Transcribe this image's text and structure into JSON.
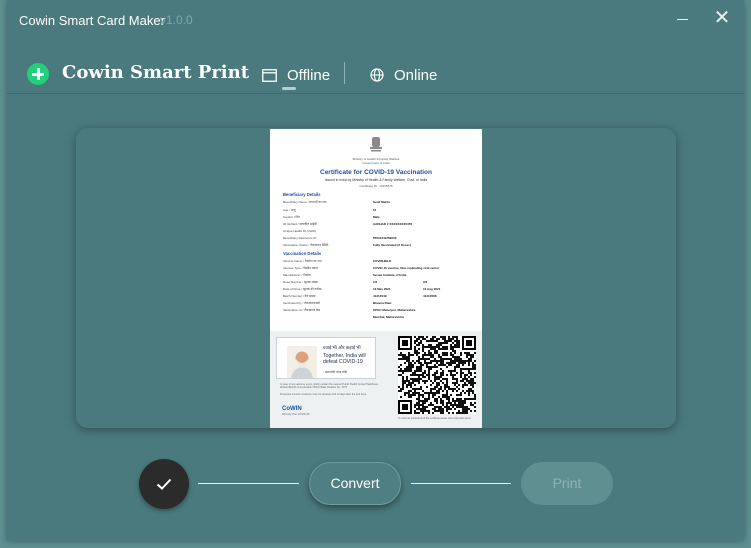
{
  "window": {
    "title": "Cowin Smart Card Maker",
    "version": "v1.0.0",
    "minimize_icon": "minimize-icon",
    "close_icon": "close-icon"
  },
  "header": {
    "brand": "Cowin Smart Print",
    "brand_icon": "plus-circle-icon",
    "tabs": [
      {
        "label": "Offline",
        "icon": "window-icon",
        "active": true
      },
      {
        "label": "Online",
        "icon": "globe-icon",
        "active": false
      }
    ]
  },
  "certificate": {
    "header_line1": "Ministry of Health & Family Welfare",
    "header_line2": "Government of India",
    "title": "Certificate for COVID-19 Vaccination",
    "subtitle": "Issued in India by Ministry of Health & Family Welfare, Govt. of India",
    "cert_id": "Certificate ID : 12345678",
    "sections": {
      "beneficiary": "Beneficiary Details",
      "vaccination": "Vaccination Details"
    },
    "beneficiary_rows": [
      {
        "key": "Beneficiary Name / लाभार्थी का नाम",
        "value": "Sunil Mehta"
      },
      {
        "key": "Age / आयु",
        "value": "51"
      },
      {
        "key": "Gender / लिंग",
        "value": "Male"
      },
      {
        "key": "ID Verified / सत्यापित आईडी",
        "value": "AADHAR # XXXXXXXX5478"
      },
      {
        "key": "Unique Health ID (UHID)",
        "value": ""
      },
      {
        "key": "Beneficiary Reference ID",
        "value": "55512341259000"
      },
      {
        "key": "Vaccination Status / टीकाकरण स्थिति",
        "value": "Fully Vaccinated (2 Doses)"
      }
    ],
    "vaccination_rows": [
      {
        "key": "Vaccine Name / वैक्सीन का नाम",
        "value": "COVISHIELD",
        "value2": ""
      },
      {
        "key": "Vaccine Type / वैक्सीन प्रकार",
        "value": "COVID-19 vaccine, Non-replicating viral vector",
        "value2": ""
      },
      {
        "key": "Manufacturer / निर्माता",
        "value": "Serum Institute of India",
        "value2": ""
      },
      {
        "key": "Dose Number / खुराक संख्या",
        "value": "1/2",
        "value2": "2/2"
      },
      {
        "key": "Date of Dose / खुराक की तारीख",
        "value": "13 May 2021",
        "value2": "19 Aug 2021"
      },
      {
        "key": "Batch Number / बैच संख्या",
        "value": "4121Z049",
        "value2": "4121Z068"
      },
      {
        "key": "Vaccinated by / टीकाकरणकर्ता",
        "value": "Bhavna Raut",
        "value2": ""
      },
      {
        "key": "Vaccination at / टीकाकरण केंद्र",
        "value": "UPHC Meherpur, Maharashtra",
        "value2": ""
      },
      {
        "key": "",
        "value": "Mumbai, Maharashtra",
        "value2": ""
      }
    ],
    "quote_hindi": "दवाई भी और कड़ाई भी",
    "quote_english": "Together, India will defeat COVID-19",
    "quote_by": "- प्रधानमंत्री नरेन्द्र मोदी",
    "fine_print_1": "In case of any adverse event, kindly contact the nearest Public Health Center/Healthcare Worker/District Immunization Officer/State Helpline No. 1075",
    "fine_print_2": "Protective immune response may not develop until 14 days after the 2nd dose",
    "cowin_logo": "CoWIN",
    "cowin_tag": "Winning Over COVID-19",
    "qr_footer": "To verify the authenticity of this certificate please visit verify.cowin.gov.in"
  },
  "steps": {
    "done_icon": "check-icon",
    "convert_label": "Convert",
    "print_label": "Print"
  },
  "colors": {
    "window_bg": "#4a7a7d",
    "brand_green": "#20d07a",
    "step_done": "#2b2b2b"
  }
}
